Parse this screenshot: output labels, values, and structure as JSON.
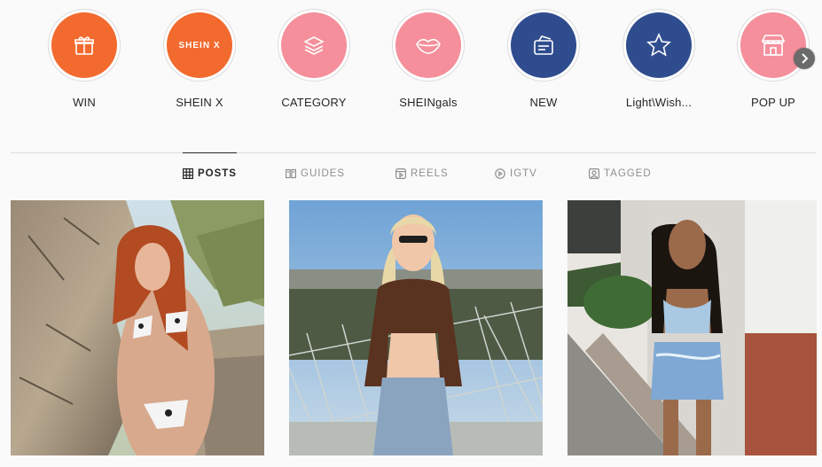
{
  "highlights": [
    {
      "label": "WIN",
      "color": "#f26a2e",
      "icon": "gift-icon"
    },
    {
      "label": "SHEIN X",
      "color": "#f26a2e",
      "icon": "shein-x-logo",
      "logo_text": "SHEIN X"
    },
    {
      "label": "CATEGORY",
      "color": "#f48f9b",
      "icon": "stack-icon"
    },
    {
      "label": "SHEINgals",
      "color": "#f48f9b",
      "icon": "lips-icon"
    },
    {
      "label": "NEW",
      "color": "#2f4d8e",
      "icon": "badge-icon"
    },
    {
      "label": "Light\\Wish...",
      "color": "#2f4d8e",
      "icon": "star-icon"
    },
    {
      "label": "POP UP",
      "color": "#f48f9b",
      "icon": "storefront-icon"
    }
  ],
  "next_arrow": {
    "icon": "chevron-right-icon"
  },
  "tabs": [
    {
      "label": "POSTS",
      "icon": "grid-icon",
      "active": true
    },
    {
      "label": "GUIDES",
      "icon": "guides-icon",
      "active": false
    },
    {
      "label": "REELS",
      "icon": "reels-icon",
      "active": false
    },
    {
      "label": "IGTV",
      "icon": "igtv-icon",
      "active": false
    },
    {
      "label": "TAGGED",
      "icon": "tagged-icon",
      "active": false
    }
  ],
  "posts": [
    {
      "description_icon": "photo-post-1"
    },
    {
      "description_icon": "photo-post-2"
    },
    {
      "description_icon": "photo-post-3"
    }
  ]
}
